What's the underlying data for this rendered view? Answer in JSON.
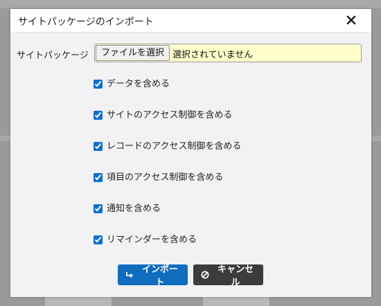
{
  "dialog": {
    "title": "サイトパッケージのインポート",
    "close_icon": "close-icon"
  },
  "file": {
    "label": "サイトパッケージ",
    "button_label": "ファイルを選択",
    "status": "選択されていません"
  },
  "options": [
    {
      "label": "データを含める",
      "checked": true
    },
    {
      "label": "サイトのアクセス制御を含める",
      "checked": true
    },
    {
      "label": "レコードのアクセス制御を含める",
      "checked": true
    },
    {
      "label": "項目のアクセス制御を含める",
      "checked": true
    },
    {
      "label": "通知を含める",
      "checked": true
    },
    {
      "label": "リマインダーを含める",
      "checked": true
    }
  ],
  "actions": {
    "import_label": "インポート",
    "import_icon": "import-arrow-icon",
    "cancel_label": "キャンセル",
    "cancel_icon": "cancel-circle-icon"
  },
  "colors": {
    "import": "#0f6dbf",
    "cancel": "#3c3c3c",
    "file_input_bg": "#ffffcc"
  }
}
